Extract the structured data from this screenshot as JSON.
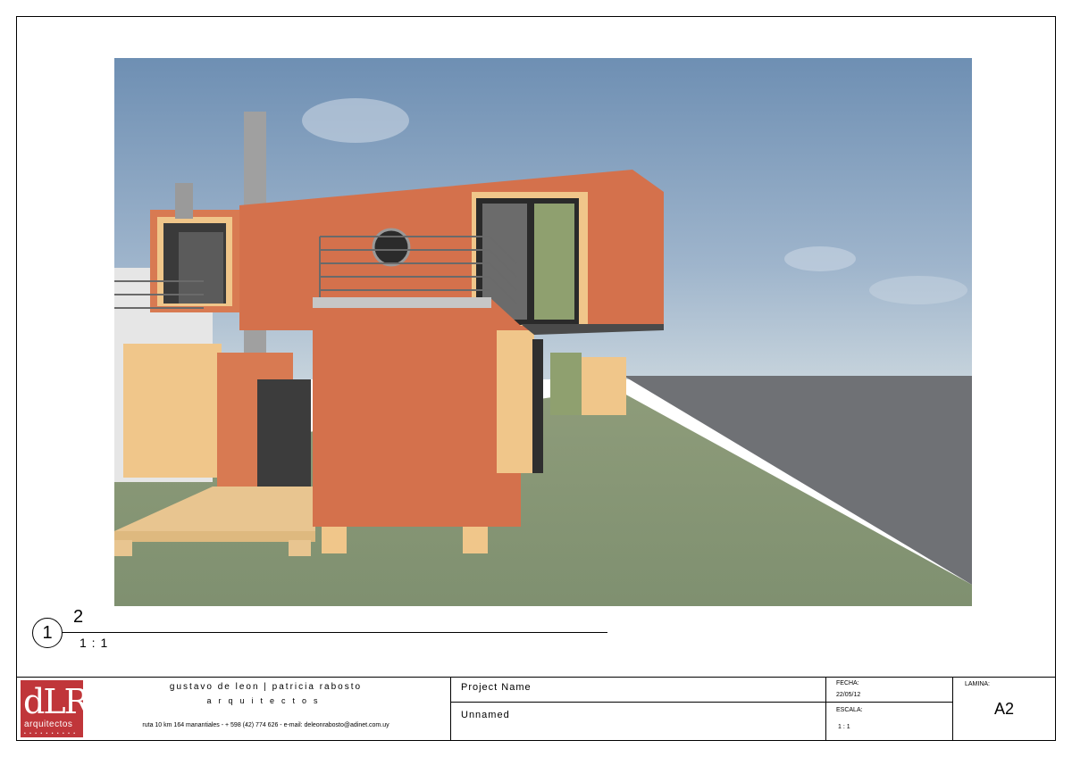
{
  "view": {
    "number": "1",
    "name": "2",
    "scale": "1 : 1"
  },
  "render_description_icon": "house-render-image",
  "firm": {
    "logo_mark": "dLR",
    "logo_sub": "arquitectos",
    "logo_dots": "• • • • • • • • • •",
    "name": "gustavo de leon  |  patricia rabosto",
    "subtitle": "arquitectos",
    "address": "ruta 10 km 164 manantiales - + 598 (42) 774 626 - e-mail: deleonrabosto@adinet.com.uy"
  },
  "project": {
    "name_label": "Project Name",
    "name_value": "Unnamed"
  },
  "meta": {
    "fecha_label": "FECHA:",
    "fecha_value": "22/05/12",
    "escala_label": "ESCALA:",
    "escala_value": "1 : 1",
    "lamina_label": "LAMINA:",
    "lamina_value": "A2"
  },
  "colors": {
    "brand_red": "#c0363a",
    "wall_orange": "#d6734e",
    "wood": "#f0c68a",
    "grass": "#8a9a78",
    "sky": "#7d9bbb"
  }
}
